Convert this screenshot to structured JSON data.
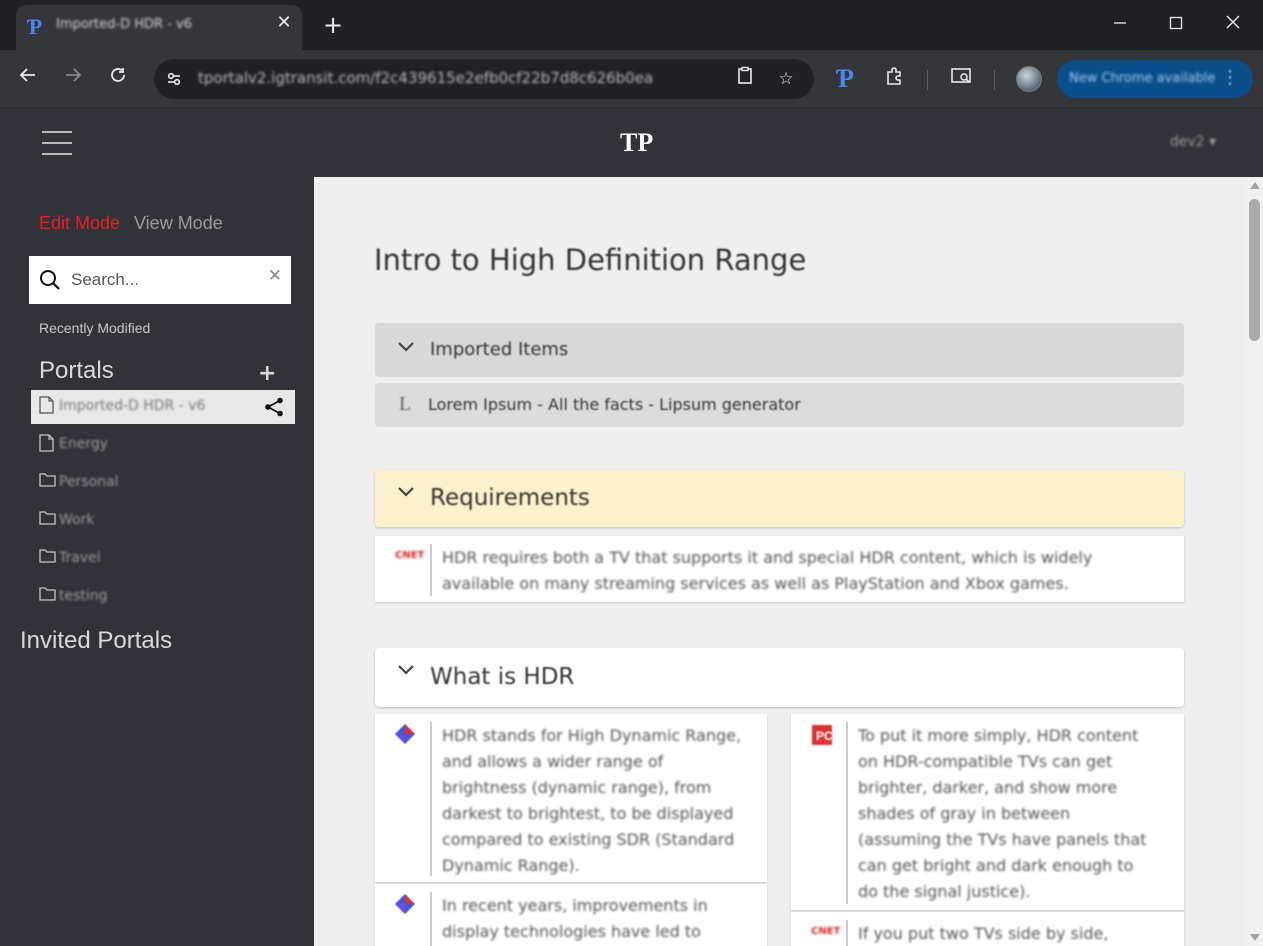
{
  "browser": {
    "tab_title": "Imported-D HDR - v6",
    "url": "tportalv2.igtransit.com/f2c439615e2efb0cf22b7d8c626b0ea",
    "update_button": "New Chrome available",
    "icons": [
      "back-icon",
      "forward-icon",
      "reload-icon",
      "site-info-icon",
      "clipboard-icon",
      "star-icon",
      "extension-icon",
      "cast-icon",
      "profile-avatar",
      "more-icon"
    ]
  },
  "header": {
    "logo": "TP",
    "user": "dev2 ▾"
  },
  "sidebar": {
    "edit_mode": "Edit Mode",
    "view_mode": "View Mode",
    "search_placeholder": "Search...",
    "recently_modified": "Recently Modified",
    "portals_heading": "Portals",
    "portals": [
      {
        "label": "Imported-D HDR - v6",
        "type": "page",
        "selected": true
      },
      {
        "label": "Energy",
        "type": "page"
      },
      {
        "label": "Personal",
        "type": "folder"
      },
      {
        "label": "Work",
        "type": "folder"
      },
      {
        "label": "Travel",
        "type": "folder"
      },
      {
        "label": "testing",
        "type": "folder"
      }
    ],
    "invited_heading": "Invited Portals"
  },
  "main": {
    "title": "Intro to High Definition Range",
    "sections": {
      "imported": {
        "heading": "Imported Items",
        "item": "Lorem Ipsum - All the facts - Lipsum generator"
      },
      "requirements": {
        "heading": "Requirements",
        "item": "HDR requires both a TV that supports it and special HDR content, which is widely available on many streaming services as well as PlayStation and Xbox games.",
        "item_badge": "CNET"
      },
      "what_is_hdr": {
        "heading": "What is HDR",
        "left_items": [
          "HDR stands for High Dynamic Range, and allows a wider range of brightness (dynamic range), from darkest to brightest, to be displayed compared to existing SDR (Standard Dynamic Range).",
          "In recent years, improvements in display technologies have led to"
        ],
        "right_items": [
          "To put it more simply, HDR content on HDR-compatible TVs can get brighter, darker, and show more shades of gray in between (assuming the TVs have panels that can get bright and dark enough to do the signal justice).",
          "If you put two TVs side by side,"
        ],
        "right_badge": "CNET"
      }
    }
  },
  "colors": {
    "edit_mode": "#e8201f",
    "requirements_bg": "#fdf1cc",
    "imported_bg": "#d8d8d8",
    "browser_accent": "#4a86f0"
  }
}
